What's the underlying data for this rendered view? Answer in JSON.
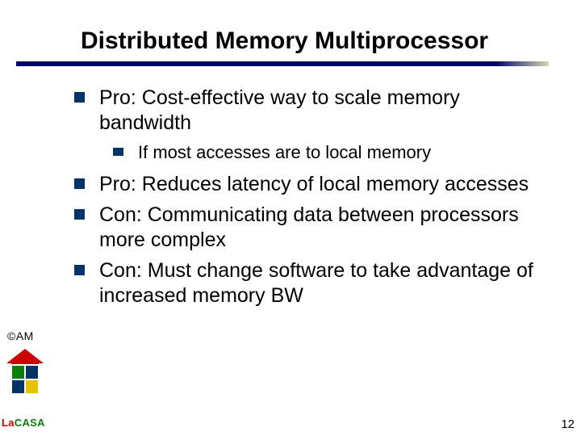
{
  "title": "Distributed Memory Multiprocessor",
  "bullets": {
    "b1": "Pro: Cost-effective way to scale memory bandwidth",
    "b1_sub": "If most accesses are to local memory",
    "b2": "Pro: Reduces latency of local memory accesses",
    "b3": "Con:  Communicating data between processors more complex",
    "b4": "Con: Must change software to take advantage of increased memory BW"
  },
  "footer": {
    "am": "©AM",
    "lacasa_la": "La",
    "lacasa_casa": "CASA",
    "slidenum": "12"
  },
  "colors": {
    "bullet_square": "#003366",
    "title_underline_dark": "#03036a",
    "title_underline_light": "#d6d6b0",
    "logo_red": "#cc0000",
    "logo_green": "#0a7e07",
    "logo_navy": "#003366",
    "logo_yellow": "#e6c200"
  }
}
